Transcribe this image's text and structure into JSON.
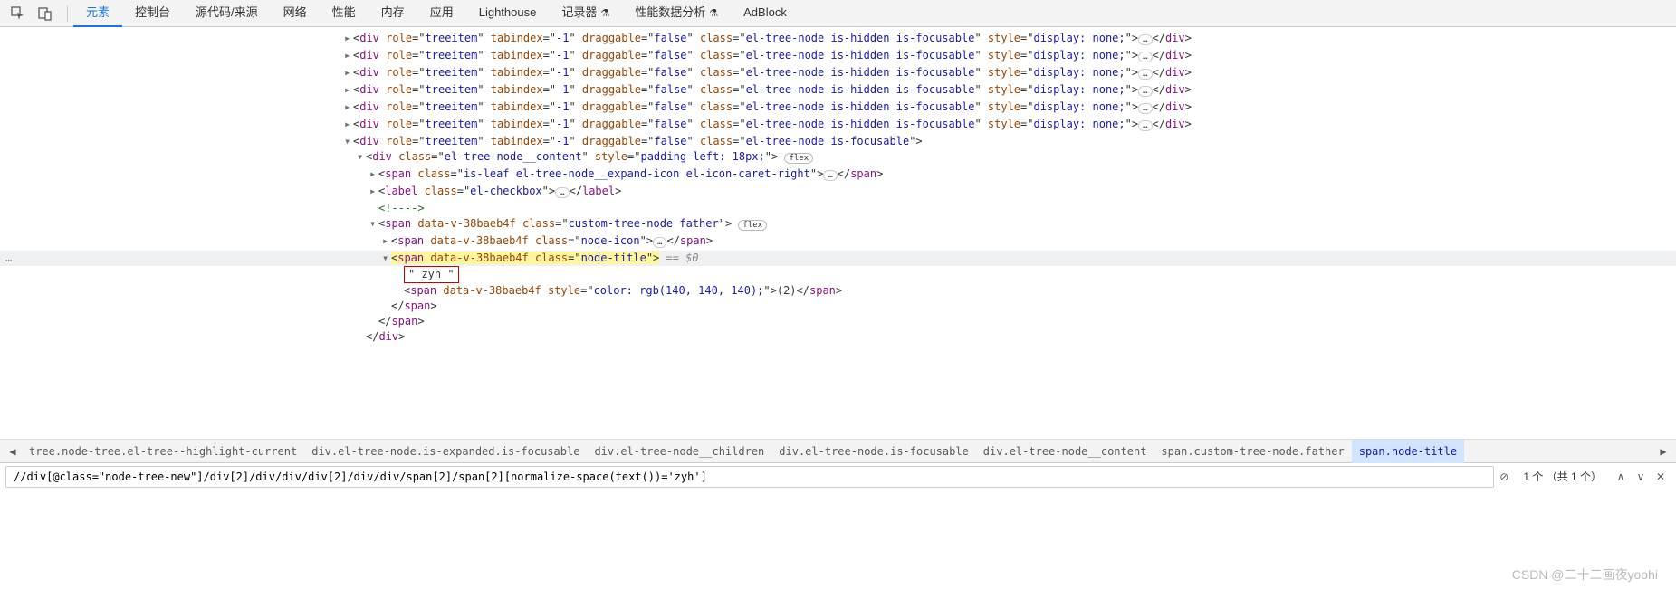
{
  "tabs": {
    "items": [
      {
        "label": "元素",
        "active": true
      },
      {
        "label": "控制台"
      },
      {
        "label": "源代码/来源"
      },
      {
        "label": "网络"
      },
      {
        "label": "性能"
      },
      {
        "label": "内存"
      },
      {
        "label": "应用"
      },
      {
        "label": "Lighthouse"
      },
      {
        "label": "记录器",
        "beta": true
      },
      {
        "label": "性能数据分析",
        "beta": true
      },
      {
        "label": "AdBlock"
      }
    ],
    "beta_glyph": "⚗"
  },
  "dom": {
    "hidden_row": "<div role=\"treeitem\" tabindex=\"-1\" draggable=\"false\" class=\"el-tree-node is-hidden is-focusable\" style=\"display: none;\">",
    "hidden_count": 6,
    "open_treeitem": "<div role=\"treeitem\" tabindex=\"-1\" draggable=\"false\" class=\"el-tree-node is-focusable\">",
    "content_open": "<div class=\"el-tree-node__content\" style=\"padding-left: 18px;\">",
    "leaf_span": "<span class=\"is-leaf el-tree-node__expand-icon el-icon-caret-right\">",
    "label_open": "<label class=\"el-checkbox\">",
    "close_span": "</span>",
    "close_label": "</label>",
    "close_div": "</div>",
    "comment": "<!---->",
    "custom_node": "<span data-v-38baeb4f class=\"custom-tree-node father\">",
    "node_icon": "<span data-v-38baeb4f class=\"node-icon\">",
    "node_title": "<span data-v-38baeb4f class=\"node-title\">",
    "text_zyh": "\" zyh \"",
    "count_span_open": "<span data-v-38baeb4f style=\"color: rgb(140, 140, 140);\">",
    "count_text": "(2)",
    "sel_mark": "== $0",
    "flex": "flex",
    "dots": "…",
    "gutter_dots": "…"
  },
  "breadcrumb": {
    "items": [
      "tree.node-tree.el-tree--highlight-current",
      "div.el-tree-node.is-expanded.is-focusable",
      "div.el-tree-node__children",
      "div.el-tree-node.is-focusable",
      "div.el-tree-node__content",
      "span.custom-tree-node.father",
      "span.node-title"
    ],
    "left": "◀",
    "right": "▶"
  },
  "search": {
    "value": "//div[@class=\"node-tree-new\"]/div[2]/div/div/div[2]/div/div/span[2]/span[2][normalize-space(text())='zyh']",
    "count": "1 个 （共 1 个）",
    "cancel": "⊘",
    "up": "∧",
    "down": "∨",
    "close": "✕"
  },
  "watermark": "CSDN @二十二画夜yoohi"
}
